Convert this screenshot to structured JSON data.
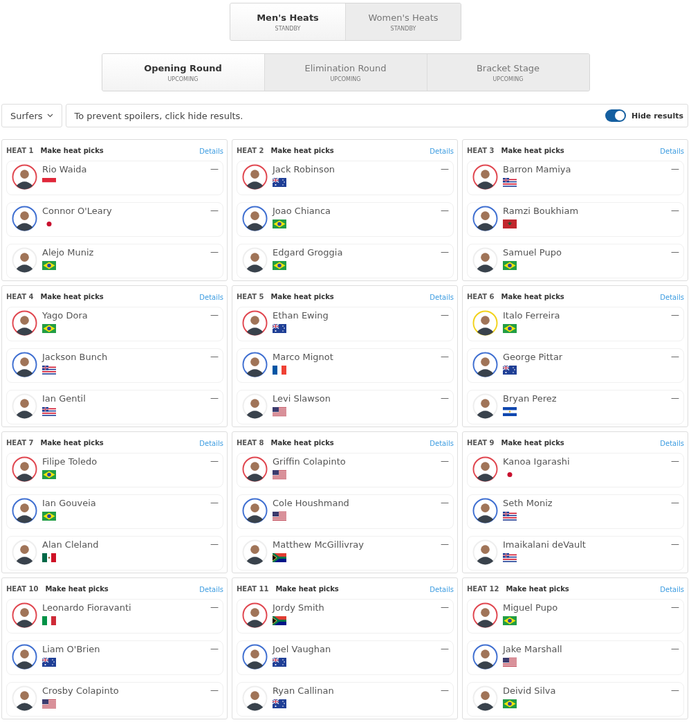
{
  "gender_tabs": [
    {
      "label": "Men's Heats",
      "status": "STANDBY",
      "selected": true
    },
    {
      "label": "Women's Heats",
      "status": "STANDBY",
      "selected": false
    }
  ],
  "round_tabs": [
    {
      "label": "Opening Round",
      "status": "UPCOMING",
      "selected": true
    },
    {
      "label": "Elimination Round",
      "status": "UPCOMING",
      "selected": false
    },
    {
      "label": "Bracket Stage",
      "status": "UPCOMING",
      "selected": false
    }
  ],
  "filter": {
    "dropdown": "Surfers",
    "message": "To prevent spoilers, click hide results.",
    "toggle_label": "Hide results",
    "on": true
  },
  "heats": [
    {
      "title": "HEAT 1",
      "action": "Make heat picks",
      "link": "Details",
      "surfers": [
        {
          "name": "Rio Waida",
          "flag": {
            "kind": "id"
          },
          "color": "#e0464f",
          "score": "—"
        },
        {
          "name": "Connor O'Leary",
          "flag": {
            "kind": "jp"
          },
          "color": "#3f6fd1",
          "score": "—"
        },
        {
          "name": "Alejo Muniz",
          "flag": {
            "kind": "br"
          },
          "color": "#eeeeee",
          "score": "—"
        }
      ]
    },
    {
      "title": "HEAT 2",
      "action": "Make heat picks",
      "link": "Details",
      "surfers": [
        {
          "name": "Jack Robinson",
          "flag": {
            "kind": "au"
          },
          "color": "#e0464f",
          "score": "—"
        },
        {
          "name": "Joao Chianca",
          "flag": {
            "kind": "br"
          },
          "color": "#3f6fd1",
          "score": "—"
        },
        {
          "name": "Edgard Groggia",
          "flag": {
            "kind": "br"
          },
          "color": "#eeeeee",
          "score": "—"
        }
      ]
    },
    {
      "title": "HEAT 3",
      "action": "Make heat picks",
      "link": "Details",
      "surfers": [
        {
          "name": "Barron Mamiya",
          "flag": {
            "kind": "hi"
          },
          "color": "#e0464f",
          "score": "—"
        },
        {
          "name": "Ramzi Boukhiam",
          "flag": {
            "kind": "ma"
          },
          "color": "#3f6fd1",
          "score": "—"
        },
        {
          "name": "Samuel Pupo",
          "flag": {
            "kind": "br"
          },
          "color": "#eeeeee",
          "score": "—"
        }
      ]
    },
    {
      "title": "HEAT 4",
      "action": "Make heat picks",
      "link": "Details",
      "surfers": [
        {
          "name": "Yago Dora",
          "flag": {
            "kind": "br"
          },
          "color": "#e0464f",
          "score": "—"
        },
        {
          "name": "Jackson Bunch",
          "flag": {
            "kind": "hi"
          },
          "color": "#3f6fd1",
          "score": "—"
        },
        {
          "name": "Ian Gentil",
          "flag": {
            "kind": "hi"
          },
          "color": "#eeeeee",
          "score": "—"
        }
      ]
    },
    {
      "title": "HEAT 5",
      "action": "Make heat picks",
      "link": "Details",
      "surfers": [
        {
          "name": "Ethan Ewing",
          "flag": {
            "kind": "au"
          },
          "color": "#e0464f",
          "score": "—"
        },
        {
          "name": "Marco Mignot",
          "flag": {
            "kind": "fr"
          },
          "color": "#3f6fd1",
          "score": "—"
        },
        {
          "name": "Levi Slawson",
          "flag": {
            "kind": "us"
          },
          "color": "#eeeeee",
          "score": "—"
        }
      ]
    },
    {
      "title": "HEAT 6",
      "action": "Make heat picks",
      "link": "Details",
      "surfers": [
        {
          "name": "Italo Ferreira",
          "flag": {
            "kind": "br"
          },
          "color": "#f2d21b",
          "score": "—"
        },
        {
          "name": "George Pittar",
          "flag": {
            "kind": "au"
          },
          "color": "#3f6fd1",
          "score": "—"
        },
        {
          "name": "Bryan Perez",
          "flag": {
            "kind": "sv"
          },
          "color": "#eeeeee",
          "score": "—"
        }
      ]
    },
    {
      "title": "HEAT 7",
      "action": "Make heat picks",
      "link": "Details",
      "surfers": [
        {
          "name": "Filipe Toledo",
          "flag": {
            "kind": "br"
          },
          "color": "#e0464f",
          "score": "—"
        },
        {
          "name": "Ian Gouveia",
          "flag": {
            "kind": "br"
          },
          "color": "#3f6fd1",
          "score": "—"
        },
        {
          "name": "Alan Cleland",
          "flag": {
            "kind": "mx"
          },
          "color": "#eeeeee",
          "score": "—"
        }
      ]
    },
    {
      "title": "HEAT 8",
      "action": "Make heat picks",
      "link": "Details",
      "surfers": [
        {
          "name": "Griffin Colapinto",
          "flag": {
            "kind": "us"
          },
          "color": "#e0464f",
          "score": "—"
        },
        {
          "name": "Cole Houshmand",
          "flag": {
            "kind": "us"
          },
          "color": "#3f6fd1",
          "score": "—"
        },
        {
          "name": "Matthew McGillivray",
          "flag": {
            "kind": "za"
          },
          "color": "#eeeeee",
          "score": "—"
        }
      ]
    },
    {
      "title": "HEAT 9",
      "action": "Make heat picks",
      "link": "Details",
      "surfers": [
        {
          "name": "Kanoa Igarashi",
          "flag": {
            "kind": "jp"
          },
          "color": "#e0464f",
          "score": "—"
        },
        {
          "name": "Seth Moniz",
          "flag": {
            "kind": "hi"
          },
          "color": "#3f6fd1",
          "score": "—"
        },
        {
          "name": "Imaikalani deVault",
          "flag": {
            "kind": "hi"
          },
          "color": "#eeeeee",
          "score": "—"
        }
      ]
    },
    {
      "title": "HEAT 10",
      "action": "Make heat picks",
      "link": "Details",
      "surfers": [
        {
          "name": "Leonardo Fioravanti",
          "flag": {
            "kind": "it"
          },
          "color": "#e0464f",
          "score": "—"
        },
        {
          "name": "Liam O'Brien",
          "flag": {
            "kind": "au"
          },
          "color": "#3f6fd1",
          "score": "—"
        },
        {
          "name": "Crosby Colapinto",
          "flag": {
            "kind": "us"
          },
          "color": "#eeeeee",
          "score": "—"
        }
      ]
    },
    {
      "title": "HEAT 11",
      "action": "Make heat picks",
      "link": "Details",
      "surfers": [
        {
          "name": "Jordy Smith",
          "flag": {
            "kind": "za"
          },
          "color": "#e0464f",
          "score": "—"
        },
        {
          "name": "Joel Vaughan",
          "flag": {
            "kind": "au"
          },
          "color": "#3f6fd1",
          "score": "—"
        },
        {
          "name": "Ryan Callinan",
          "flag": {
            "kind": "au"
          },
          "color": "#eeeeee",
          "score": "—"
        }
      ]
    },
    {
      "title": "HEAT 12",
      "action": "Make heat picks",
      "link": "Details",
      "surfers": [
        {
          "name": "Miguel Pupo",
          "flag": {
            "kind": "br"
          },
          "color": "#e0464f",
          "score": "—"
        },
        {
          "name": "Jake Marshall",
          "flag": {
            "kind": "us"
          },
          "color": "#3f6fd1",
          "score": "—"
        },
        {
          "name": "Deivid Silva",
          "flag": {
            "kind": "br"
          },
          "color": "#eeeeee",
          "score": "—"
        }
      ]
    }
  ]
}
